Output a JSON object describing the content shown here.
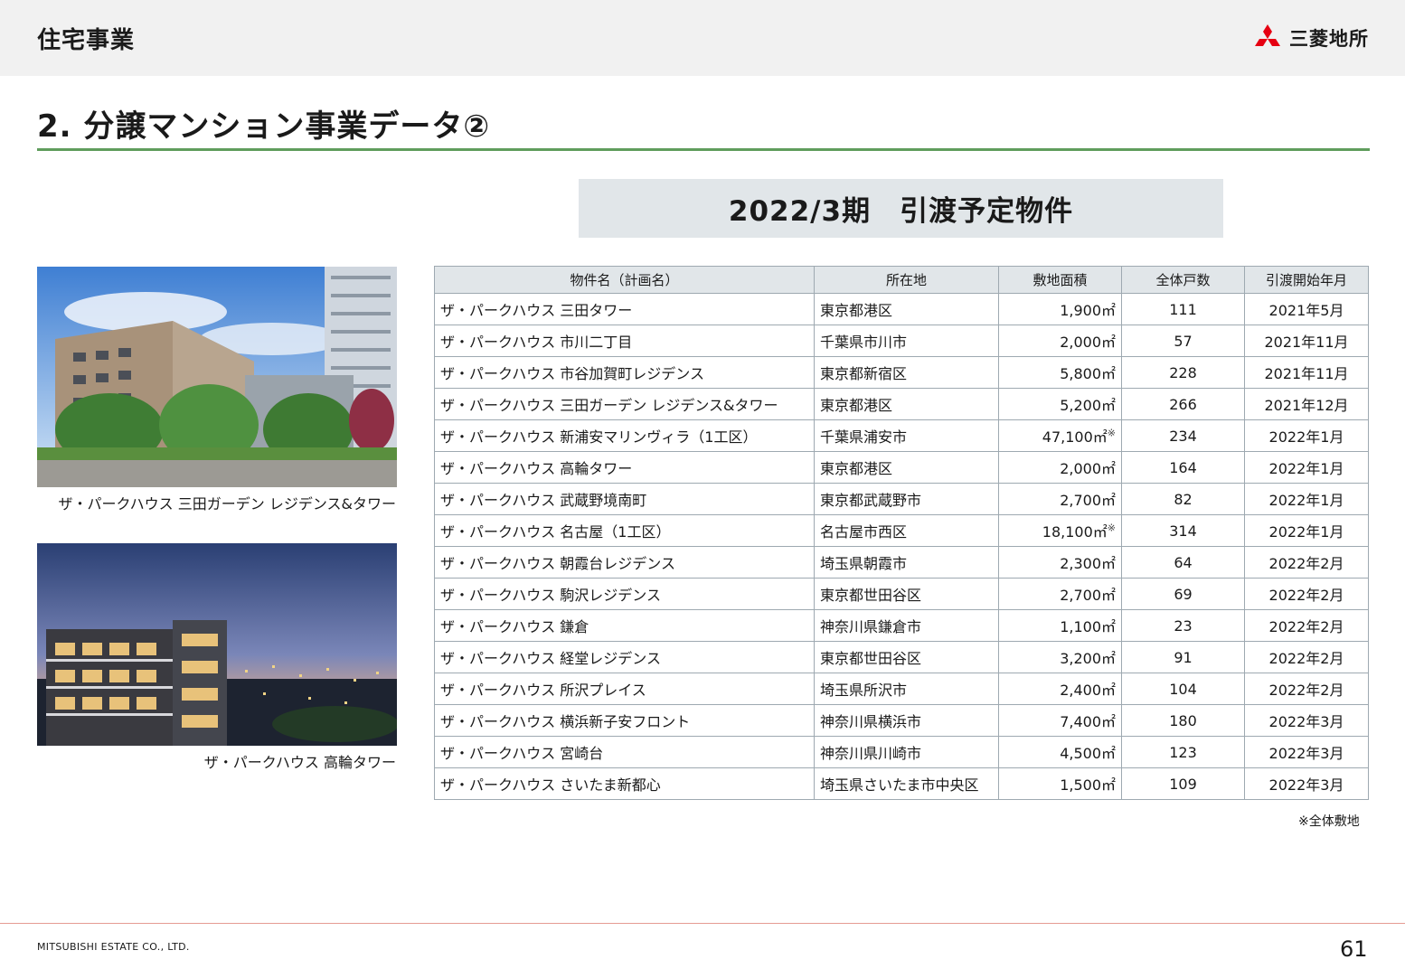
{
  "header": {
    "section_title": "住宅事業",
    "logo_text": "三菱地所",
    "logo_icon": "three-diamonds-icon",
    "logo_color": "#e60012"
  },
  "page_title": "2. 分譲マンション事業データ②",
  "period_heading": "2022/3期　引渡予定物件",
  "photos": [
    {
      "caption": "ザ・パークハウス 三田ガーデン レジデンス&タワー"
    },
    {
      "caption": "ザ・パークハウス 高輪タワー"
    }
  ],
  "table": {
    "headers": [
      "物件名（計画名）",
      "所在地",
      "敷地面積",
      "全体戸数",
      "引渡開始年月"
    ],
    "rows": [
      {
        "name": "ザ・パークハウス 三田タワー",
        "location": "東京都港区",
        "area": "1,900㎡",
        "note": "",
        "units": "111",
        "date": "2021年5月"
      },
      {
        "name": "ザ・パークハウス 市川二丁目",
        "location": "千葉県市川市",
        "area": "2,000㎡",
        "note": "",
        "units": "57",
        "date": "2021年11月"
      },
      {
        "name": "ザ・パークハウス 市谷加賀町レジデンス",
        "location": "東京都新宿区",
        "area": "5,800㎡",
        "note": "",
        "units": "228",
        "date": "2021年11月"
      },
      {
        "name": "ザ・パークハウス 三田ガーデン レジデンス&タワー",
        "location": "東京都港区",
        "area": "5,200㎡",
        "note": "",
        "units": "266",
        "date": "2021年12月"
      },
      {
        "name": "ザ・パークハウス 新浦安マリンヴィラ（1工区）",
        "location": "千葉県浦安市",
        "area": "47,100㎡",
        "note": "※",
        "units": "234",
        "date": "2022年1月"
      },
      {
        "name": "ザ・パークハウス 高輪タワー",
        "location": "東京都港区",
        "area": "2,000㎡",
        "note": "",
        "units": "164",
        "date": "2022年1月"
      },
      {
        "name": "ザ・パークハウス 武蔵野境南町",
        "location": "東京都武蔵野市",
        "area": "2,700㎡",
        "note": "",
        "units": "82",
        "date": "2022年1月"
      },
      {
        "name": "ザ・パークハウス 名古屋（1工区）",
        "location": "名古屋市西区",
        "area": "18,100㎡",
        "note": "※",
        "units": "314",
        "date": "2022年1月"
      },
      {
        "name": "ザ・パークハウス 朝霞台レジデンス",
        "location": "埼玉県朝霞市",
        "area": "2,300㎡",
        "note": "",
        "units": "64",
        "date": "2022年2月"
      },
      {
        "name": "ザ・パークハウス 駒沢レジデンス",
        "location": "東京都世田谷区",
        "area": "2,700㎡",
        "note": "",
        "units": "69",
        "date": "2022年2月"
      },
      {
        "name": "ザ・パークハウス 鎌倉",
        "location": "神奈川県鎌倉市",
        "area": "1,100㎡",
        "note": "",
        "units": "23",
        "date": "2022年2月"
      },
      {
        "name": "ザ・パークハウス 経堂レジデンス",
        "location": "東京都世田谷区",
        "area": "3,200㎡",
        "note": "",
        "units": "91",
        "date": "2022年2月"
      },
      {
        "name": "ザ・パークハウス 所沢プレイス",
        "location": "埼玉県所沢市",
        "area": "2,400㎡",
        "note": "",
        "units": "104",
        "date": "2022年2月"
      },
      {
        "name": "ザ・パークハウス 横浜新子安フロント",
        "location": "神奈川県横浜市",
        "area": "7,400㎡",
        "note": "",
        "units": "180",
        "date": "2022年3月"
      },
      {
        "name": "ザ・パークハウス 宮崎台",
        "location": "神奈川県川崎市",
        "area": "4,500㎡",
        "note": "",
        "units": "123",
        "date": "2022年3月"
      },
      {
        "name": "ザ・パークハウス さいたま新都心",
        "location": "埼玉県さいたま市中央区",
        "area": "1,500㎡",
        "note": "",
        "units": "109",
        "date": "2022年3月"
      }
    ]
  },
  "footnote": "※全体敷地",
  "footer": {
    "company": "MITSUBISHI ESTATE CO., LTD.",
    "page_number": "61"
  }
}
